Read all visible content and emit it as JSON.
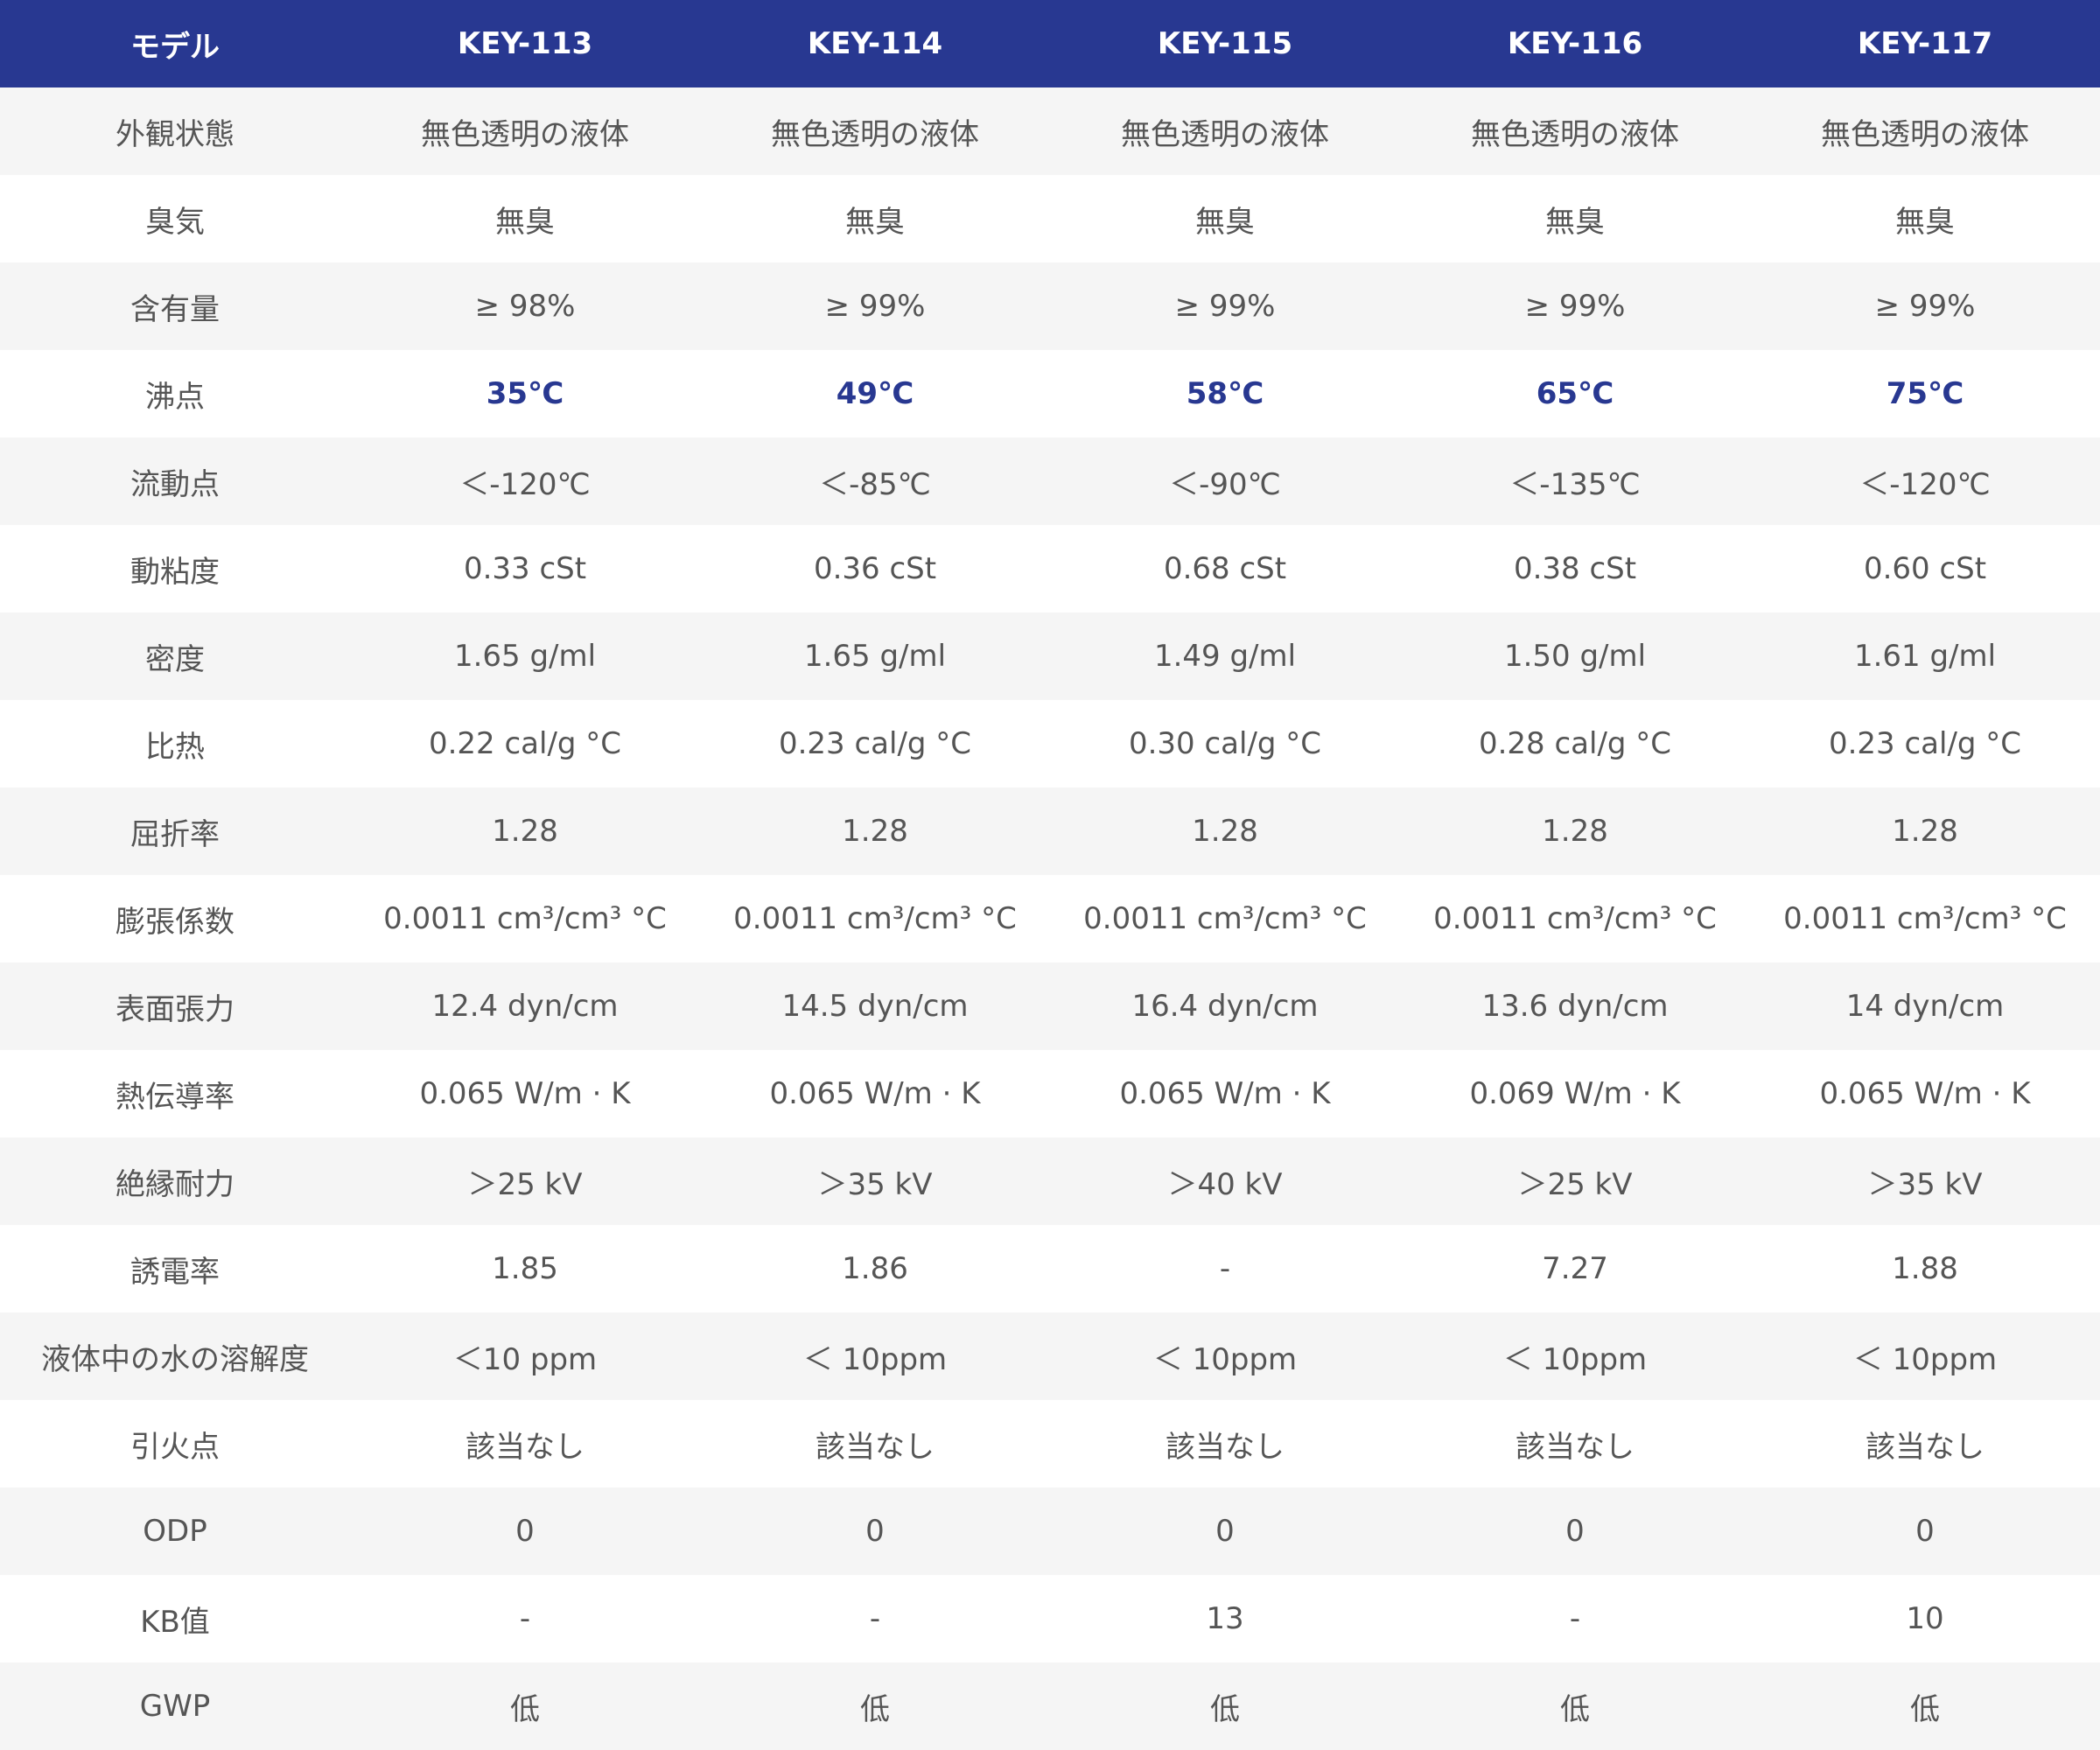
{
  "table": {
    "header": [
      "モデル",
      "KEY-113",
      "KEY-114",
      "KEY-115",
      "KEY-116",
      "KEY-117"
    ],
    "accent_color": "#283891",
    "highlight_row": "沸点",
    "rows": [
      {
        "label": "外観状態",
        "values": [
          "無色透明の液体",
          "無色透明の液体",
          "無色透明の液体",
          "無色透明の液体",
          "無色透明の液体"
        ]
      },
      {
        "label": "臭気",
        "values": [
          "無臭",
          "無臭",
          "無臭",
          "無臭",
          "無臭"
        ]
      },
      {
        "label": "含有量",
        "values": [
          "≥ 98%",
          "≥ 99%",
          "≥ 99%",
          "≥ 99%",
          "≥ 99%"
        ]
      },
      {
        "label": "沸点",
        "values": [
          "35℃",
          "49℃",
          "58℃",
          "65℃",
          "75℃"
        ]
      },
      {
        "label": "流動点",
        "values": [
          "＜-120℃",
          "＜-85℃",
          "＜-90℃",
          "＜-135℃",
          "＜-120℃"
        ]
      },
      {
        "label": "動粘度",
        "values": [
          "0.33 cSt",
          "0.36 cSt",
          "0.68 cSt",
          "0.38 cSt",
          "0.60 cSt"
        ]
      },
      {
        "label": "密度",
        "values": [
          "1.65 g/ml",
          "1.65 g/ml",
          "1.49 g/ml",
          "1.50 g/ml",
          "1.61 g/ml"
        ]
      },
      {
        "label": "比热",
        "values": [
          "0.22 cal/g °C",
          "0.23 cal/g °C",
          "0.30 cal/g °C",
          "0.28 cal/g °C",
          "0.23 cal/g °C"
        ]
      },
      {
        "label": "屈折率",
        "values": [
          "1.28",
          "1.28",
          "1.28",
          "1.28",
          "1.28"
        ]
      },
      {
        "label": "膨張係数",
        "values": [
          "0.0011 cm³/cm³ °C",
          "0.0011 cm³/cm³ °C",
          "0.0011 cm³/cm³ °C",
          "0.0011 cm³/cm³ °C",
          "0.0011 cm³/cm³ °C"
        ]
      },
      {
        "label": "表面張力",
        "values": [
          "12.4 dyn/cm",
          "14.5 dyn/cm",
          "16.4 dyn/cm",
          "13.6 dyn/cm",
          "14 dyn/cm"
        ]
      },
      {
        "label": "熱伝導率",
        "values": [
          "0.065 W/m · K",
          "0.065 W/m · K",
          "0.065 W/m · K",
          "0.069 W/m · K",
          "0.065 W/m · K"
        ]
      },
      {
        "label": "絶縁耐力",
        "values": [
          "＞25 kV",
          "＞35 kV",
          "＞40 kV",
          "＞25 kV",
          "＞35 kV"
        ]
      },
      {
        "label": "誘電率",
        "values": [
          "1.85",
          "1.86",
          "-",
          "7.27",
          "1.88"
        ]
      },
      {
        "label": "液体中の水の溶解度",
        "values": [
          "＜10 ppm",
          "＜ 10ppm",
          "＜ 10ppm",
          "＜ 10ppm",
          "＜ 10ppm"
        ]
      },
      {
        "label": "引火点",
        "values": [
          "該当なし",
          "該当なし",
          "該当なし",
          "該当なし",
          "該当なし"
        ]
      },
      {
        "label": "ODP",
        "values": [
          "0",
          "0",
          "0",
          "0",
          "0"
        ]
      },
      {
        "label": "KB值",
        "values": [
          "-",
          "-",
          "13",
          "-",
          "10"
        ]
      },
      {
        "label": "GWP",
        "values": [
          "低",
          "低",
          "低",
          "低",
          "低"
        ]
      }
    ]
  }
}
